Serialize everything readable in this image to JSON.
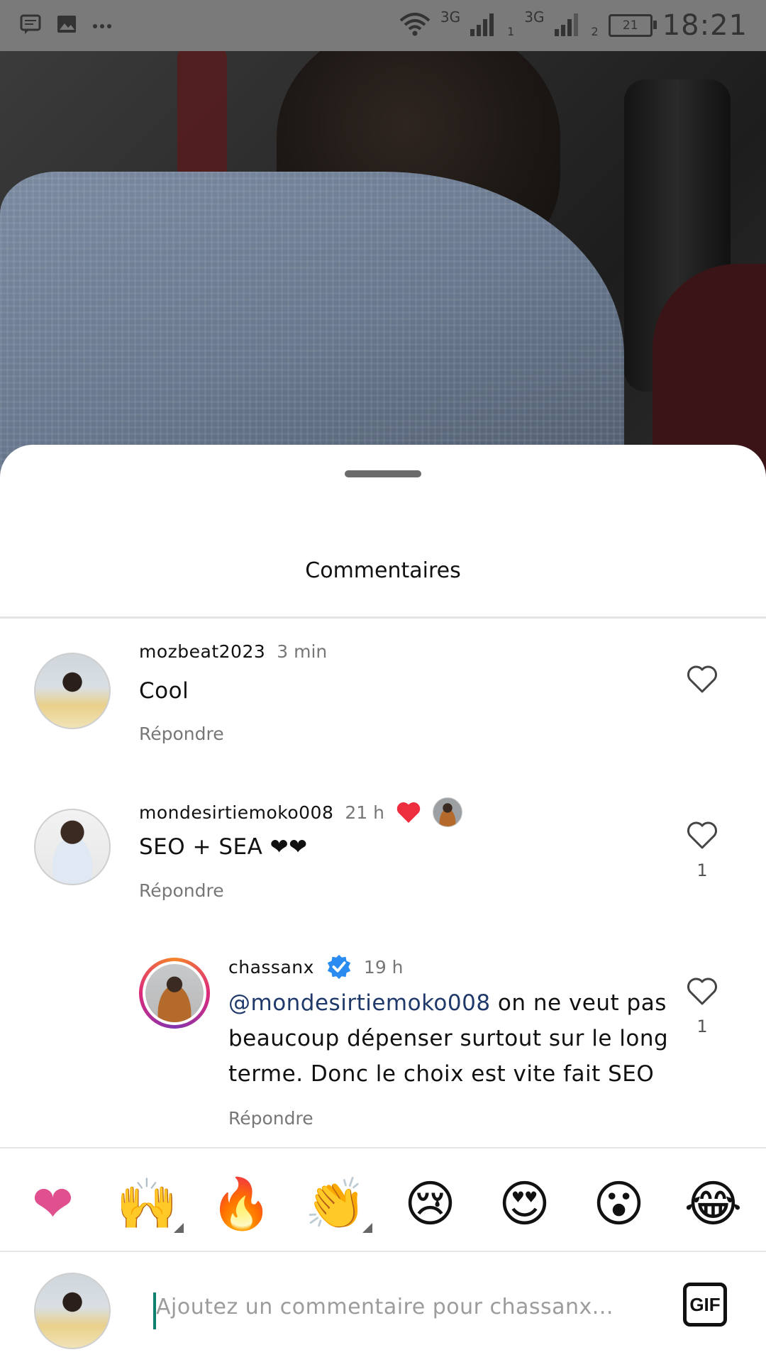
{
  "status_bar": {
    "icons": [
      "message-icon",
      "image-icon",
      "more-icon",
      "wifi-icon",
      "signal-icon",
      "signal-icon"
    ],
    "network_1": "3G",
    "network_2": "3G",
    "sim_1": "1",
    "sim_2": "2",
    "battery": "21",
    "time": "18:21"
  },
  "sheet": {
    "title": "Commentaires"
  },
  "comments": [
    {
      "username": "mozbeat2023",
      "time": "3 min",
      "text": "Cool",
      "reply_label": "Répondre",
      "likes": ""
    },
    {
      "username": "mondesirtiemoko008",
      "time": "21 h",
      "text": "SEO + SEA ❤❤",
      "reply_label": "Répondre",
      "likes": "1",
      "liked_by_author": true
    },
    {
      "username": "chassanx",
      "verified": true,
      "time": "19 h",
      "mention": "@mondesirtiemoko008",
      "text_line1": " on ne veut pas",
      "text_line2": "beaucoup dépenser surtout sur le long",
      "text_line3": "terme. Donc le choix est vite fait SEO",
      "reply_label": "Répondre",
      "likes": "1"
    }
  ],
  "emoji_bar": {
    "emojis": [
      "❤",
      "🙌",
      "🔥",
      "👏",
      "😢",
      "😍",
      "😮",
      "😂"
    ]
  },
  "composer": {
    "placeholder": "Ajoutez un commentaire pour chassanx...",
    "gif_label": "GIF"
  },
  "colors": {
    "accent_pink": "#e0508f",
    "heart_red": "#ed2e3e",
    "verified_blue": "#2a8cf0",
    "caret_teal": "#12806f"
  }
}
